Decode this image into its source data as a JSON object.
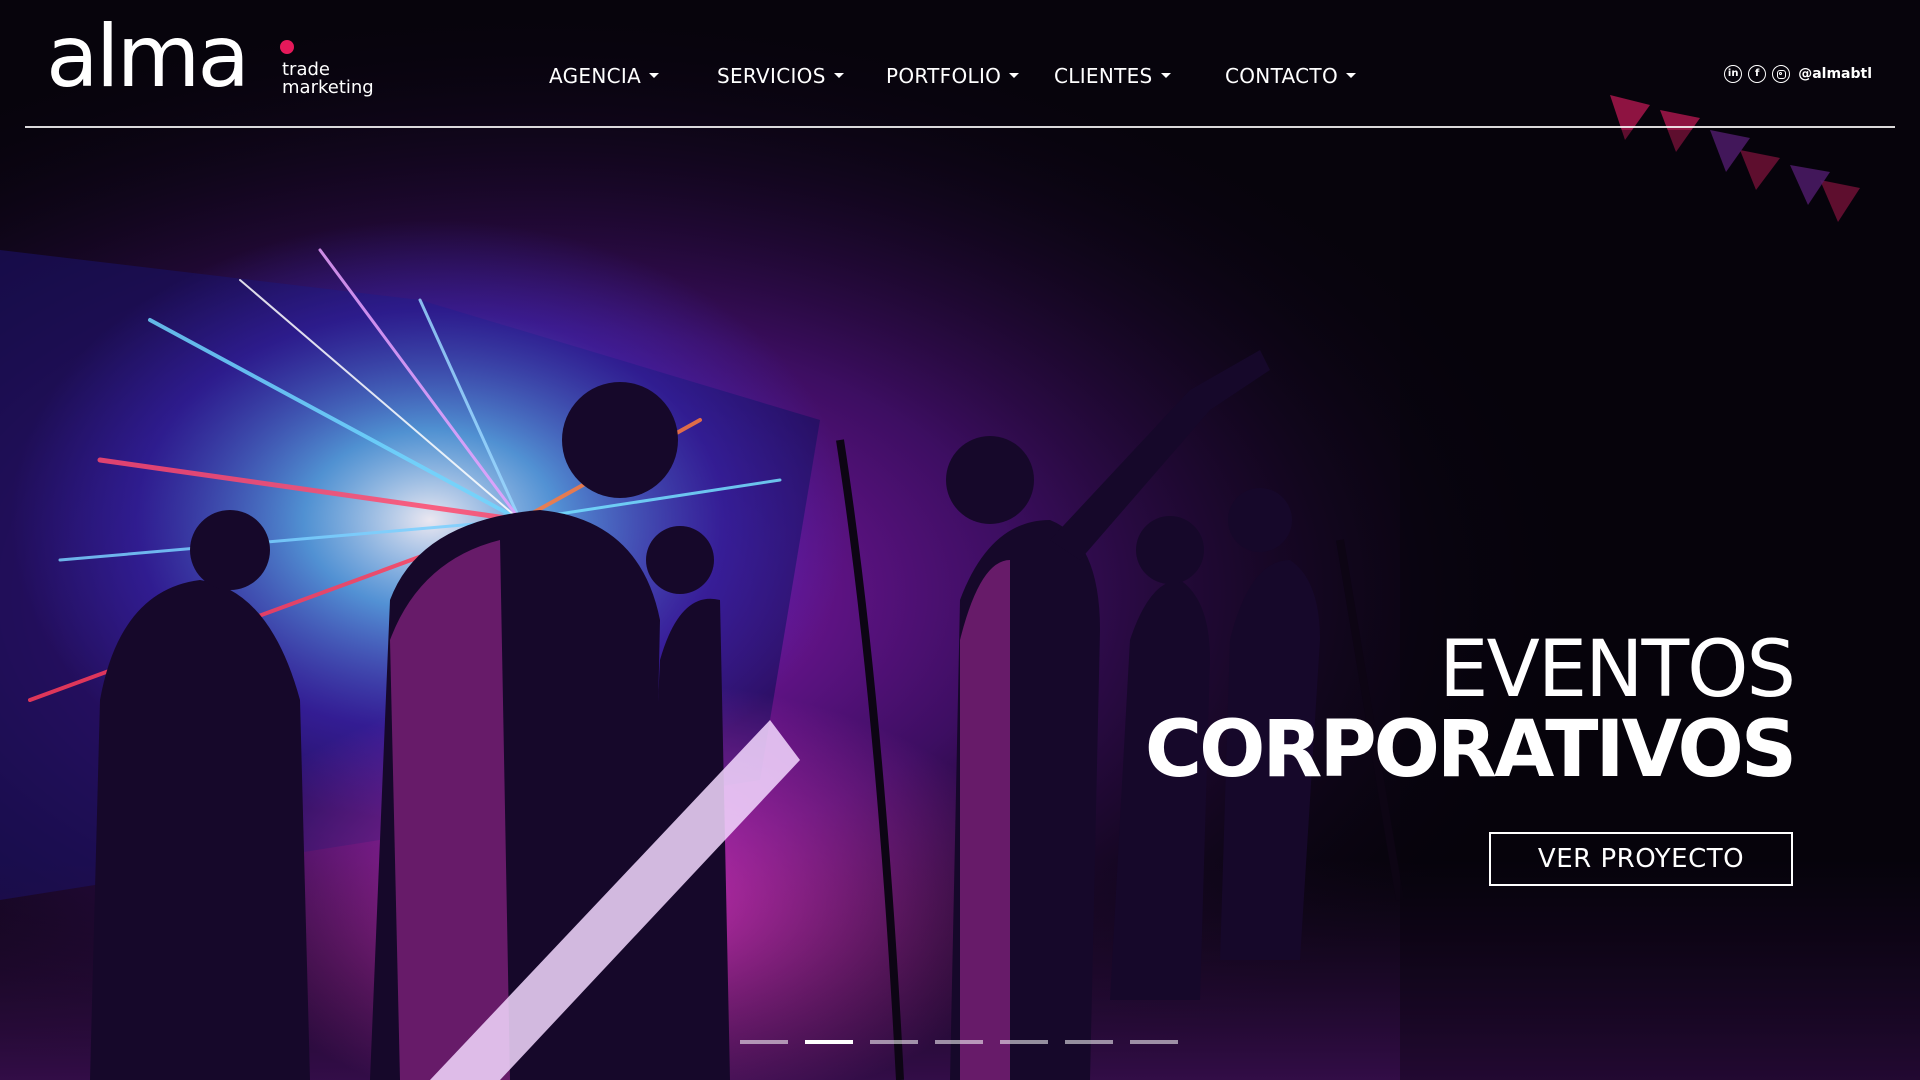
{
  "brand": {
    "name": "alma",
    "tagline_line1": "trade",
    "tagline_line2": "marketing",
    "accent_color": "#e5195a"
  },
  "nav": {
    "items": [
      {
        "label": "AGENCIA",
        "has_dropdown": true
      },
      {
        "label": "SERVICIOS",
        "has_dropdown": true
      },
      {
        "label": "PORTFOLIO",
        "has_dropdown": true
      },
      {
        "label": "CLIENTES",
        "has_dropdown": true
      },
      {
        "label": "CONTACTO",
        "has_dropdown": true
      }
    ]
  },
  "social": {
    "icons": [
      "linkedin-icon",
      "facebook-icon",
      "instagram-icon"
    ],
    "linkedin_glyph": "in",
    "facebook_glyph": "f",
    "handle": "@almabtl"
  },
  "hero": {
    "headline_line1": "EVENTOS",
    "headline_line2": "CORPORATIVOS",
    "cta_label": "VER PROYECTO",
    "slide_count": 7,
    "active_slide": 2
  }
}
